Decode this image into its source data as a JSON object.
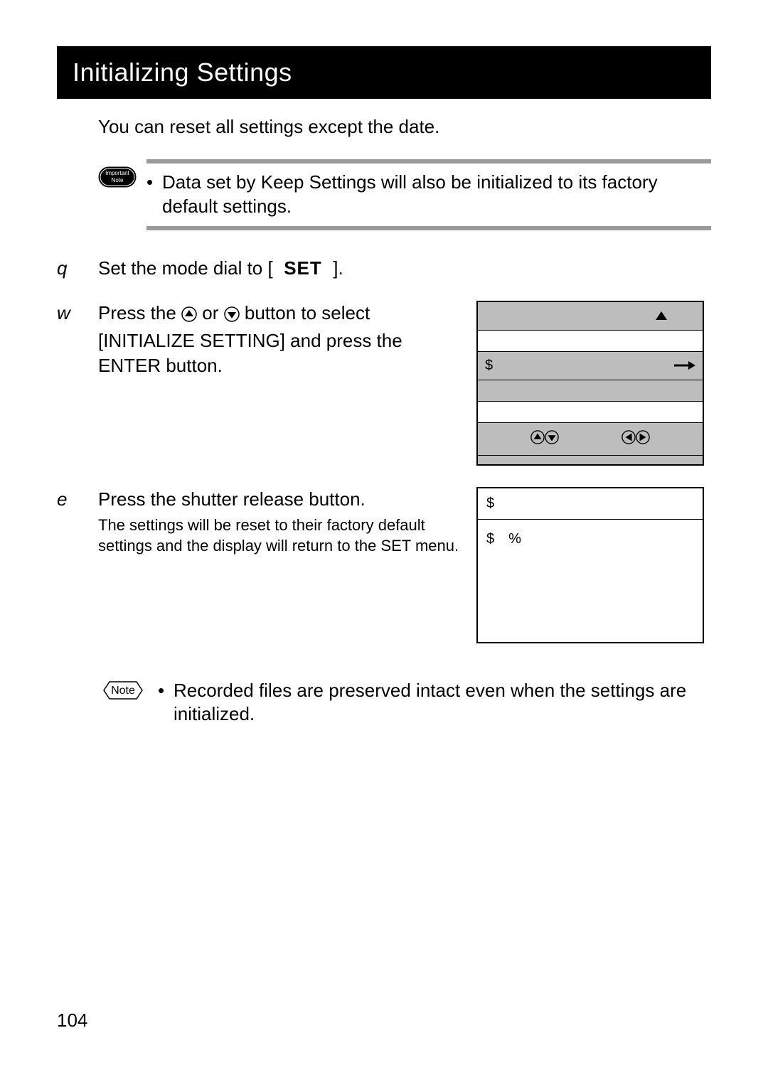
{
  "title": "Initializing Settings",
  "intro": "You can reset all settings except the date.",
  "important_label_top": "Important",
  "important_label_bottom": "Note",
  "important_text": "Data set by Keep Settings will also be initialized to its factory default settings.",
  "step1": {
    "num": "q",
    "pre": "Set the mode dial to [",
    "set": "SET",
    "post": "]."
  },
  "step2": {
    "num": "w",
    "line": "Press the     or     button to select [INITIALIZE SETTING] and press the ENTER button.",
    "pre": "Press the ",
    "mid": " or ",
    "post": " button to select [INITIALIZE SETTING] and press the ENTER button."
  },
  "step3": {
    "num": "e",
    "main": "Press the shutter release button.",
    "sub": "The settings will be reset to their factory default settings and the display will return to the SET menu."
  },
  "fig1": {
    "row3_left": "$"
  },
  "fig2": {
    "hdr": "$",
    "body": "$ %"
  },
  "note_label": "Note",
  "note_text": "Recorded files are preserved intact even when the settings are initialized.",
  "page_number": "104"
}
